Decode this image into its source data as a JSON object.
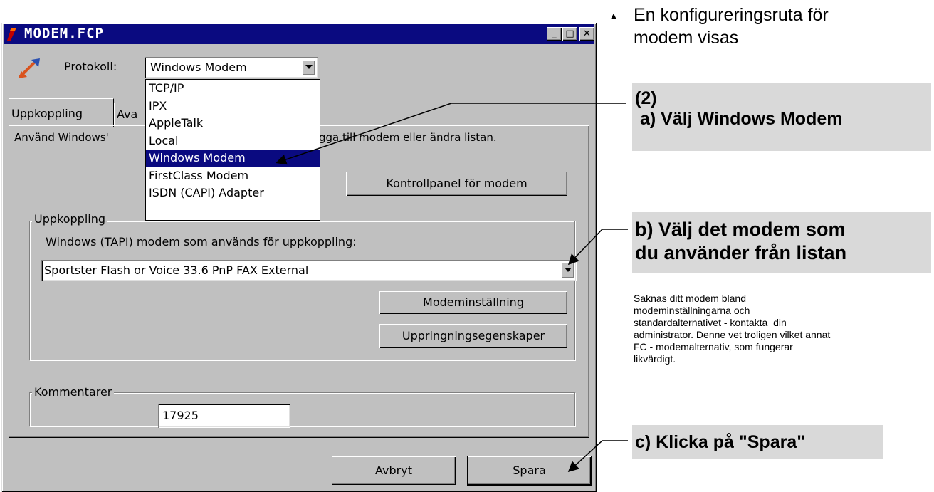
{
  "window": {
    "title": "MODEM.FCP",
    "minimize": "_",
    "maximize": "□",
    "close": "✕"
  },
  "protocol": {
    "label": "Protokoll:",
    "selected": "Windows Modem",
    "options": [
      "TCP/IP",
      "IPX",
      "AppleTalk",
      "Local",
      "Windows Modem",
      "FirstClass Modem",
      "ISDN (CAPI) Adapter"
    ],
    "highlighted_index": 4
  },
  "tabs": [
    {
      "label": "Uppkoppling",
      "active": true
    },
    {
      "label": "Ava",
      "active": false
    }
  ],
  "tab_text_left": "Använd Windows'",
  "tab_text_right": "gga till modem eller ändra listan.",
  "control_panel_button": "Kontrollpanel för modem",
  "connection_group": {
    "legend": "Uppkoppling",
    "label": "Windows (TAPI) modem som används för uppkoppling:",
    "modem_selected": "Sportster Flash or Voice 33.6 PnP FAX External",
    "modem_settings_button": "Modeminställning",
    "dialing_properties_button": "Uppringningsegenskaper"
  },
  "comments_group": {
    "legend": "Kommentarer",
    "value": "17925"
  },
  "footer": {
    "cancel_button": "Avbryt",
    "save_button": "Spara"
  },
  "annotations": {
    "bullet": "▲",
    "intro": "En konfigureringsruta för\nmodem visas",
    "step_a": "(2)\n a) Välj Windows Modem",
    "step_b": "b) Välj det modem som\ndu använder från listan",
    "note": "Saknas ditt modem bland\nmodeminställningarna och\nstandardalternativet - kontakta  din\nadministrator. Denne vet troligen vilket annat\nFC - modemalternativ, som fungerar\nlikvärdigt.",
    "step_c": "c) Klicka på \"Spara\""
  },
  "colors": {
    "titlebar": "#0a0a80",
    "window_face": "#c0c0c0",
    "callout_bg": "#d9d9d9",
    "selection": "#0a0a80"
  }
}
